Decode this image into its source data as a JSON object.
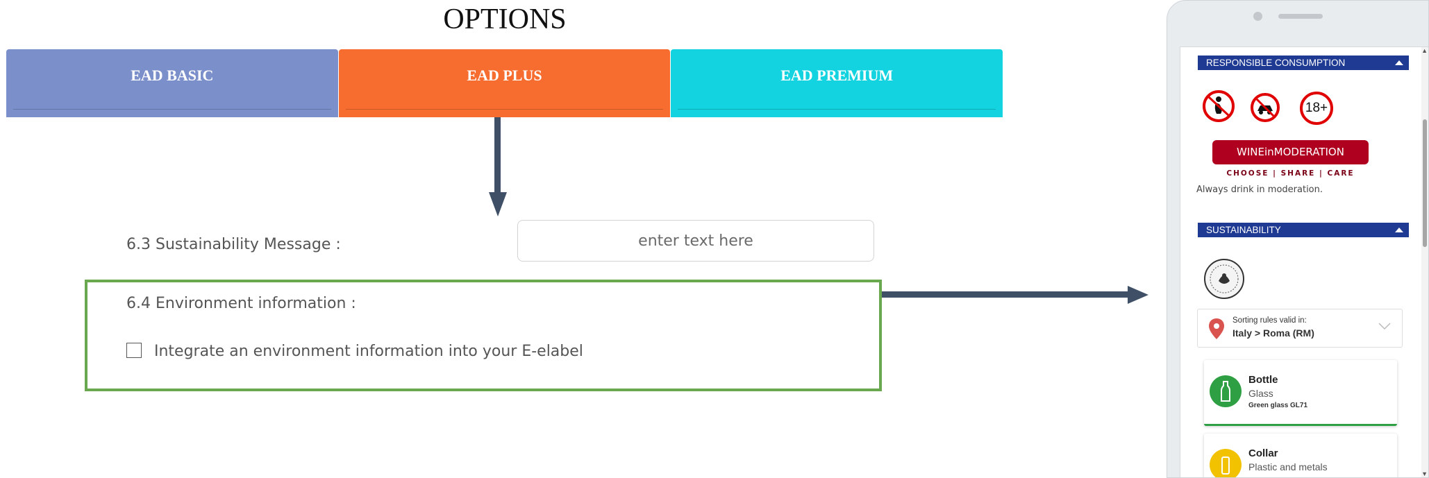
{
  "title": "OPTIONS",
  "tabs": [
    {
      "label": "EAD BASIC"
    },
    {
      "label": "EAD PLUS"
    },
    {
      "label": "EAD PREMIUM"
    }
  ],
  "form": {
    "sustainability_label": "6.3 Sustainability Message :",
    "sustainability_placeholder": "enter text here",
    "environment_label": "6.4 Environment information :",
    "environment_checkbox_label": "Integrate an environment information into your E-elabel"
  },
  "phone": {
    "responsible_header": "RESPONSIBLE CONSUMPTION",
    "age_sign": "18+",
    "wim_logo_text": "WINEinMODERATION",
    "wim_tagline": "CHOOSE | SHARE | CARE",
    "moderation_text": "Always drink in moderation.",
    "sustainability_header": "SUSTAINABILITY",
    "sorting_label": "Sorting rules valid in:",
    "sorting_location": "Italy > Roma (RM)",
    "items": [
      {
        "title": "Bottle",
        "material": "Glass",
        "code": "Green glass GL71",
        "color": "#2ea043"
      },
      {
        "title": "Collar",
        "material": "Plastic and metals",
        "code": "",
        "color": "#f2c200"
      }
    ]
  },
  "colors": {
    "tab_basic": "#7b8fca",
    "tab_plus": "#f76d30",
    "tab_premium": "#12d3df",
    "highlight_border": "#6aa84f",
    "arrow": "#3e4f66",
    "section_header": "#1f3a93"
  }
}
